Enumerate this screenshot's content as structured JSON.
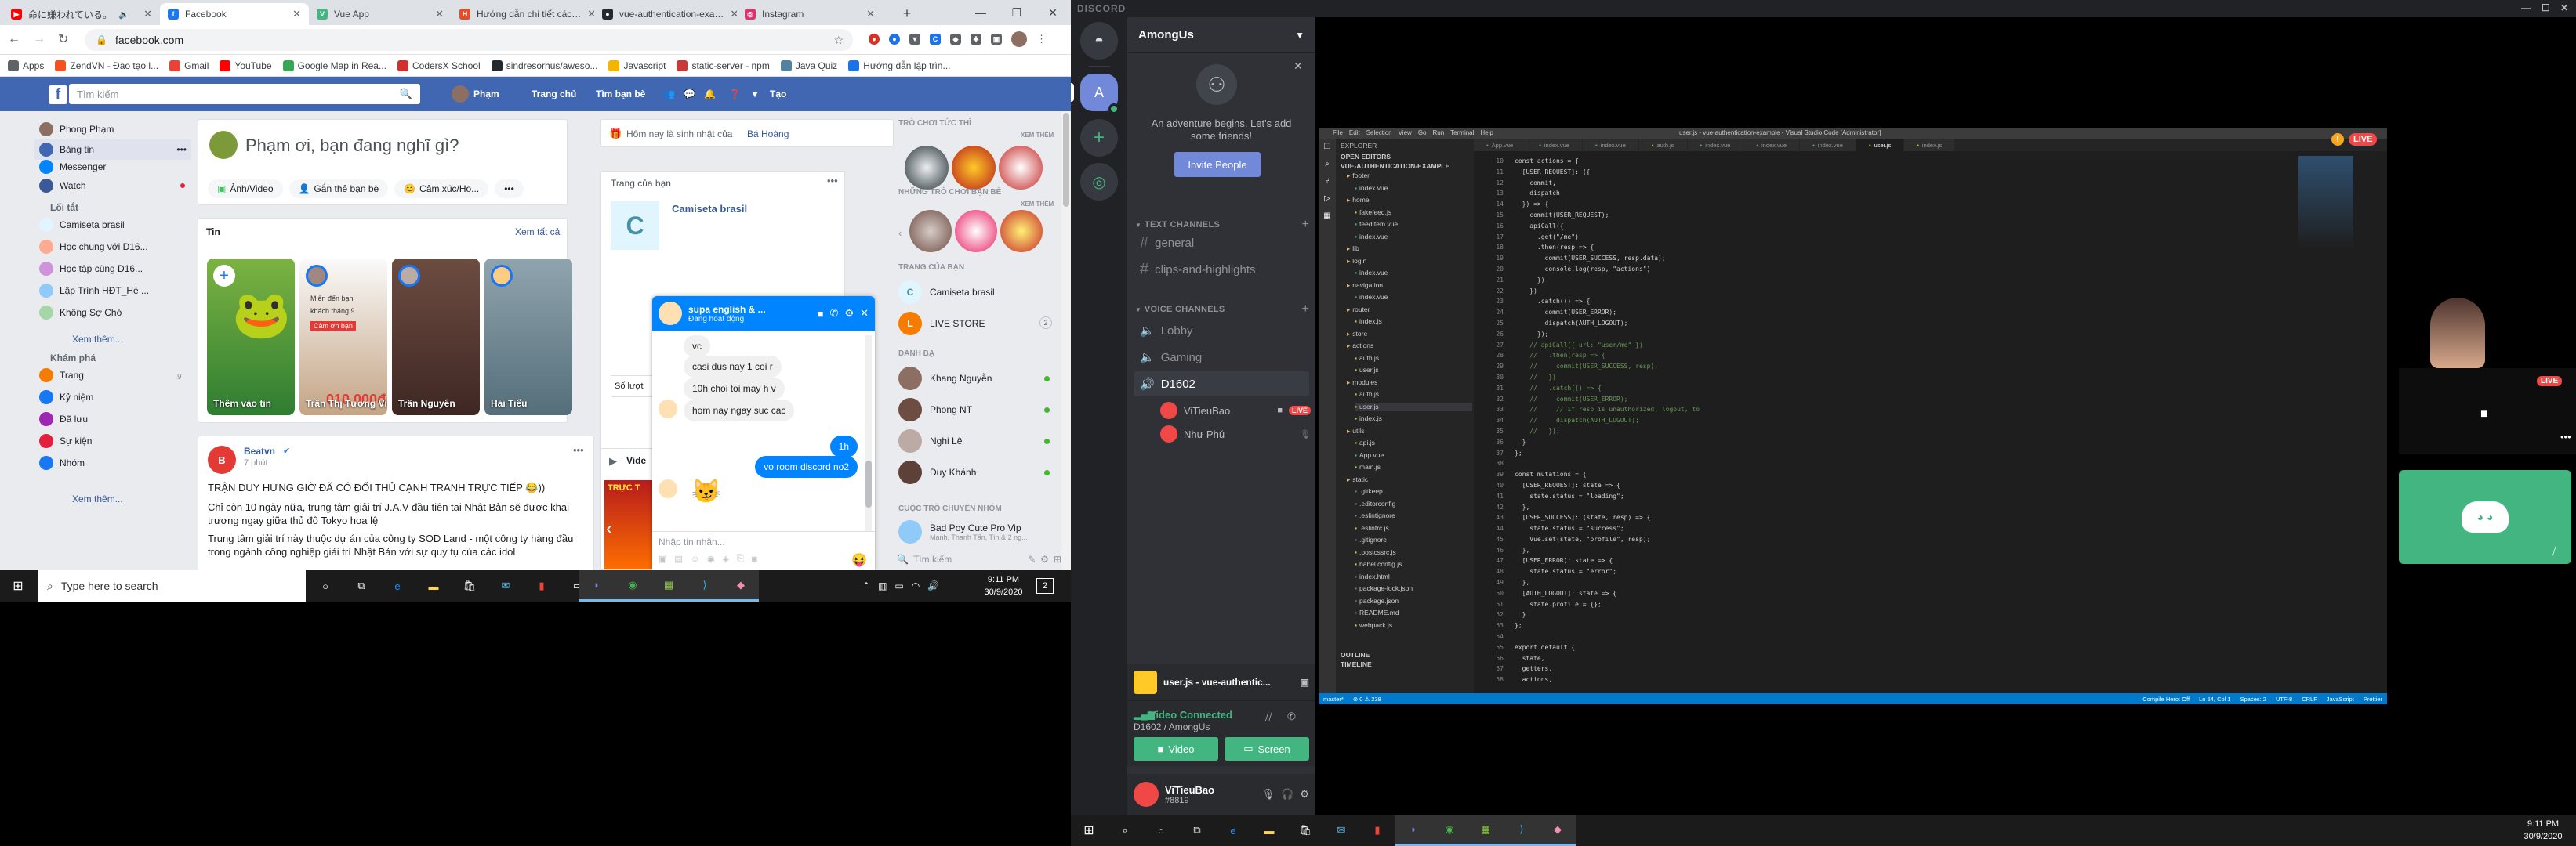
{
  "chrome": {
    "tabs": [
      {
        "label": "命に嫌われている。",
        "color": "#ff0000"
      },
      {
        "label": "Facebook",
        "color": "#1877f2",
        "active": true
      },
      {
        "label": "Vue App",
        "color": "#41b883"
      },
      {
        "label": "Hướng dẫn chi tiết các…",
        "color": "#e44d26"
      },
      {
        "label": "vue-authentication-exa…",
        "color": "#24292e"
      },
      {
        "label": "Instagram",
        "color": "#e1306c"
      }
    ],
    "url": "facebook.com",
    "bookmarks": [
      {
        "label": "Apps",
        "icon": "apps-icon",
        "color": "#5f6368"
      },
      {
        "label": "ZendVN - Đào tạo l...",
        "icon": "zendvn-icon",
        "color": "#f4511e"
      },
      {
        "label": "Gmail",
        "icon": "gmail-icon",
        "color": "#ea4335"
      },
      {
        "label": "YouTube",
        "icon": "youtube-icon",
        "color": "#ff0000"
      },
      {
        "label": "Google Map in Rea...",
        "icon": "maps-icon",
        "color": "#34a853"
      },
      {
        "label": "CodersX School",
        "icon": "codersx-icon",
        "color": "#d32f2f"
      },
      {
        "label": "sindresorhus/aweso...",
        "icon": "github-icon",
        "color": "#24292e"
      },
      {
        "label": "Javascript",
        "icon": "folder-icon",
        "color": "#f5b400"
      },
      {
        "label": "static-server - npm",
        "icon": "npm-icon",
        "color": "#cb3837"
      },
      {
        "label": "Java Quiz",
        "icon": "java-icon",
        "color": "#5382a1"
      },
      {
        "label": "Hướng dẫn lập trìn...",
        "icon": "guide-icon",
        "color": "#1a73e8"
      }
    ]
  },
  "facebook": {
    "search_placeholder": "Tìm kiếm",
    "nav": {
      "user": "Phạm",
      "home": "Trang chủ",
      "find_friends": "Tìm bạn bè",
      "create": "Tạo"
    },
    "left_nav": {
      "profile": "Phong Phạm",
      "items": [
        "Bảng tin",
        "Messenger",
        "Watch"
      ],
      "shortcuts_title": "Lối tắt",
      "shortcuts": [
        "Camiseta brasil",
        "Học chung với D16...",
        "Học tập cùng D16...",
        "Lập Trình HĐT_Hè ...",
        "Không Sợ Chó"
      ],
      "see_more": "Xem thêm...",
      "explore_title": "Khám phá",
      "explore": [
        "Trang",
        "Kỷ niệm",
        "Đã lưu",
        "Sự kiện",
        "Nhóm"
      ],
      "explore_see_more": "Xem thêm...",
      "page_count": "9"
    },
    "composer": {
      "prompt": "Phạm ơi, bạn đang nghĩ gì?",
      "photo": "Ảnh/Video",
      "tag": "Gắn thẻ bạn bè",
      "feeling": "Cảm xúc/Ho..."
    },
    "stories": {
      "title": "Tin",
      "see_all": "Xem tất cả",
      "items": [
        "Thêm vào tin",
        "Trần Thị Tương Vi",
        "Trần Nguyên",
        "Hải Tiểu"
      ],
      "story_text": [
        "Miễn đến bạn",
        "khách tháng 9",
        "Cảm ơn bạn",
        "010.000đ"
      ]
    },
    "post": {
      "author": "Beatvn",
      "time": "7 phút",
      "headline": "TRẬN DUY HƯNG GIỜ ĐÃ CÓ ĐỐI THỦ CẠNH TRANH TRỰC TIẾP 😂))",
      "body1": "Chỉ còn 10 ngày nữa, trung tâm giải trí J.A.V đầu tiên tại Nhật Bản sẽ được khai trương ngay giữa thủ đô Tokyo hoa lệ",
      "body2": "Trung tâm giải trí này thuộc dự án của công ty SOD Land - một công ty hàng đầu trong ngành công nghiệp giải trí Nhật Bản với sự quy tụ của các idol"
    },
    "birthday": "Hôm nay là sinh nhật của",
    "birthday_name": "Bá Hoàng",
    "your_pages": {
      "title": "Trang của bạn",
      "page_name": "Camiseta brasil",
      "letter": "C",
      "count_label": "Số lượt"
    },
    "video_label": "Vide",
    "live_label": "TRỰC T",
    "right_col": {
      "games_title": "TRÒ CHƠI TỨC THÌ",
      "see_more": "XEM THÊM",
      "friends_games_title": "NHỮNG TRÒ CHƠI BẠN BÈ",
      "pages_title": "TRANG CỦA BẠN",
      "pages": [
        "Camiseta brasil",
        "LIVE STORE"
      ],
      "pages_count": "2",
      "contacts_title": "DANH BẠ",
      "contacts": [
        "Khang Nguyễn",
        "Phong NT",
        "Nghi Lê",
        "Duy Khánh"
      ],
      "convos_title": "CUỘC TRÒ CHUYỆN NHÓM",
      "group": "Bad Poy Cute Pro Vip",
      "group_members": "Mạnh, Thanh Tấn, Tín & 2 ng...",
      "search_placeholder": "Tìm kiếm"
    },
    "chat": {
      "name": "supa english & ...",
      "status": "Đang hoạt động",
      "messages": [
        {
          "text": "vc",
          "dir": "in"
        },
        {
          "text": "casi dus nay 1 coi r",
          "dir": "in"
        },
        {
          "text": "10h choi toi may h v",
          "dir": "in"
        },
        {
          "text": "hom nay ngay suc cac",
          "dir": "in"
        },
        {
          "text": "1h",
          "dir": "out"
        },
        {
          "text": "vo room discord no2",
          "dir": "out"
        }
      ],
      "sticker": "😼",
      "input_placeholder": "Nhập tin nhắn..."
    }
  },
  "taskbar_left": {
    "search_placeholder": "Type here to search",
    "time": "9:11 PM",
    "date": "30/9/2020",
    "notifications": "2"
  },
  "discord": {
    "app_title": "DISCORD",
    "server": "AmongUs",
    "promo_text": "An adventure begins. Let's add some friends!",
    "invite_button": "Invite People",
    "text_category": "TEXT CHANNELS",
    "text_channels": [
      "general",
      "clips-and-highlights"
    ],
    "voice_category": "VOICE CHANNELS",
    "voice_channels": [
      "Lobby",
      "Gaming",
      "D1602"
    ],
    "voice_users": [
      {
        "name": "ViTieuBao",
        "live": true
      },
      {
        "name": "Như Phú",
        "live": false
      }
    ],
    "live_badge": "LIVE",
    "activity": "user.js - vue-authentic...",
    "status_title": "Video Connected",
    "status_sub": "D1602 / AmongUs",
    "video_button": "Video",
    "screen_button": "Screen",
    "user": {
      "name": "ViTieuBao",
      "tag": "#8819"
    },
    "accent": "#7289da",
    "green": "#43b581",
    "guild_avatar": "A"
  },
  "vscode": {
    "title": "user.js - vue-authentication-example - Visual Studio Code [Administrator]",
    "menu": [
      "File",
      "Edit",
      "Selection",
      "View",
      "Go",
      "Run",
      "Terminal",
      "Help"
    ],
    "tabs": [
      "App.vue",
      "index.vue",
      "index.vue",
      "auth.js",
      "index.vue",
      "index.vue",
      "index.vue",
      "user.js",
      "index.js"
    ],
    "explorer_title": "EXPLORER",
    "open_editors": "OPEN EDITORS",
    "project": "VUE-AUTHENTICATION-EXAMPLE",
    "tree": [
      "footer",
      "index.vue",
      "home",
      "fakefeed.js",
      "feedItem.vue",
      "index.vue",
      "lib",
      "login",
      "index.vue",
      "navigation",
      "index.vue",
      "router",
      "index.js",
      "store",
      "actions",
      "auth.js",
      "user.js",
      "modules",
      "auth.js",
      "user.js",
      "index.js",
      "utils",
      "api.js",
      "App.vue",
      "main.js",
      "static",
      ".gitkeep",
      ".editorconfig",
      ".eslintignore",
      ".eslintrc.js",
      ".gitignore",
      ".postcssrc.js",
      "babel.config.js",
      "index.html",
      "package-lock.json",
      "package.json",
      "README.md",
      "webpack.js"
    ],
    "outline": "OUTLINE",
    "timeline": "TIMELINE",
    "line_start": 10,
    "code": [
      "const actions = {",
      "  [USER_REQUEST]: ({",
      "    commit,",
      "    dispatch",
      "  }) => {",
      "    commit(USER_REQUEST);",
      "    apiCall({",
      "      .get(\"/me\")",
      "      .then(resp => {",
      "        commit(USER_SUCCESS, resp.data);",
      "        console.log(resp, \"actions\")",
      "      })",
      "    })",
      "      .catch(() => {",
      "        commit(USER_ERROR);",
      "        dispatch(AUTH_LOGOUT);",
      "      });",
      "    // apiCall({ url: \"user/me\" })",
      "    //   .then(resp => {",
      "    //     commit(USER_SUCCESS, resp);",
      "    //   })",
      "    //   .catch(() => {",
      "    //     commit(USER_ERROR);",
      "    //     // if resp is unauthorized, logout, to",
      "    //     dispatch(AUTH_LOGOUT);",
      "    //   });",
      "  }",
      "};",
      "",
      "const mutations = {",
      "  [USER_REQUEST]: state => {",
      "    state.status = \"loading\";",
      "  },",
      "  [USER_SUCCESS]: (state, resp) => {",
      "    state.status = \"success\";",
      "    Vue.set(state, \"profile\", resp);",
      "  },",
      "  [USER_ERROR]: state => {",
      "    state.status = \"error\";",
      "  },",
      "  [AUTH_LOGOUT]: state => {",
      "    state.profile = {};",
      "  }",
      "};",
      "",
      "export default {",
      "  state,",
      "  getters,",
      "  actions,"
    ],
    "statusbar_left": "master*",
    "statusbar_problems": "⊗ 0 ⚠ 238",
    "statusbar_right": [
      "Compile Hero: Off",
      "Ln 54, Col 1",
      "Spaces: 2",
      "UTF-8",
      "CRLF",
      "JavaScript",
      "Prettier"
    ]
  },
  "stream_overlay": {
    "live": "LIVE"
  },
  "taskbar_right": {
    "time": "9:11 PM",
    "date": "30/9/2020"
  }
}
